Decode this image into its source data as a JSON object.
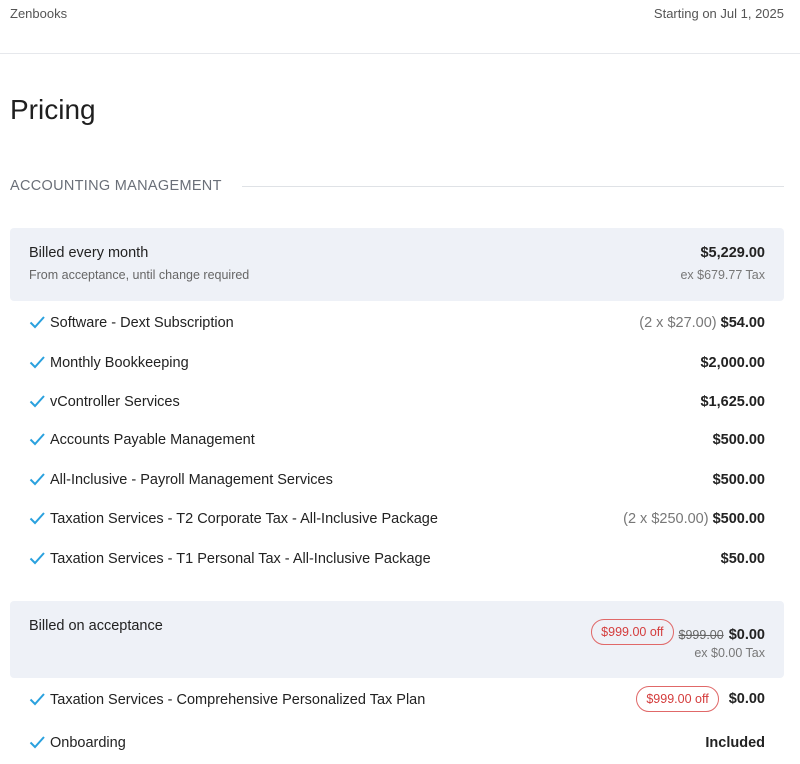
{
  "header": {
    "brand": "Zenbooks",
    "start_date": "Starting on Jul 1, 2025"
  },
  "page_title": "Pricing",
  "section": {
    "title": "ACCOUNTING MANAGEMENT"
  },
  "monthly": {
    "title": "Billed every month",
    "subtitle": "From acceptance, until change required",
    "amount": "$5,229.00",
    "tax": "ex $679.77 Tax",
    "items": [
      {
        "label": "Software - Dext Subscription",
        "qty": "(2 x $27.00)",
        "price": "$54.00"
      },
      {
        "label": "Monthly Bookkeeping",
        "qty": "",
        "price": "$2,000.00"
      },
      {
        "label": "vController Services",
        "qty": "",
        "price": "$1,625.00"
      },
      {
        "label": "Accounts Payable Management",
        "qty": "",
        "price": "$500.00"
      },
      {
        "label": "All-Inclusive - Payroll Management Services",
        "qty": "",
        "price": "$500.00"
      },
      {
        "label": "Taxation Services - T2 Corporate Tax - All-Inclusive Package",
        "qty": "(2 x $250.00)",
        "price": "$500.00"
      },
      {
        "label": "Taxation Services - T1 Personal Tax - All-Inclusive Package",
        "qty": "",
        "price": "$50.00"
      }
    ]
  },
  "acceptance": {
    "title": "Billed on acceptance",
    "discount": "$999.00 off",
    "original": "$999.00",
    "amount": "$0.00",
    "tax": "ex $0.00 Tax",
    "items": [
      {
        "label": "Taxation Services - Comprehensive Personalized Tax Plan",
        "discount": "$999.00 off",
        "price": "$0.00"
      },
      {
        "label": "Onboarding",
        "price": "Included"
      }
    ]
  },
  "colors": {
    "accent_check": "#2aa1de",
    "block_bg": "#eef1f7",
    "discount_red": "#d43c3c"
  },
  "icons": {
    "check": "check-icon"
  }
}
